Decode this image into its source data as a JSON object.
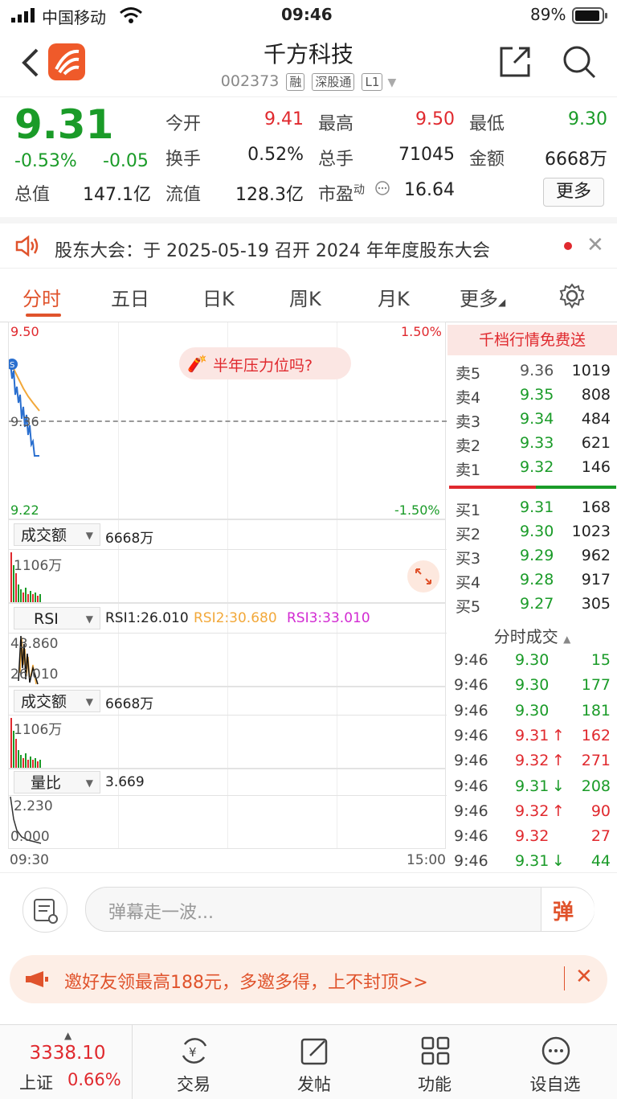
{
  "status": {
    "carrier": "中国移动",
    "time": "09:46",
    "battery": "89%"
  },
  "header": {
    "title": "千方科技",
    "code": "002373",
    "tags": [
      "融",
      "深股通",
      "L1"
    ]
  },
  "quote": {
    "price": "9.31",
    "change_pct": "-0.53%",
    "change": "-0.05",
    "fields": [
      {
        "label": "今开",
        "value": "9.41",
        "color": "red"
      },
      {
        "label": "最高",
        "value": "9.50",
        "color": "red"
      },
      {
        "label": "最低",
        "value": "9.30",
        "color": "green"
      },
      {
        "label": "换手",
        "value": "0.52%",
        "color": "normal"
      },
      {
        "label": "总手",
        "value": "71045",
        "color": "normal"
      },
      {
        "label": "金额",
        "value": "6668万",
        "color": "normal"
      },
      {
        "label": "总值",
        "value": "147.1亿",
        "color": "normal"
      },
      {
        "label": "流值",
        "value": "128.3亿",
        "color": "normal"
      },
      {
        "label": "市盈",
        "sup": "动",
        "value": "16.64",
        "color": "normal"
      }
    ],
    "more_label": "更多"
  },
  "notice": {
    "text": "股东大会：于 2025-05-19 召开 2024 年年度股东大会"
  },
  "tabs": [
    "分时",
    "五日",
    "日K",
    "周K",
    "月K",
    "更多"
  ],
  "chart": {
    "price_high": "9.50",
    "pct_high": "1.50%",
    "price_mid": "9.36",
    "price_low": "9.22",
    "pct_low": "-1.50%",
    "bubble": "半年压力位吗?",
    "vol_selector": "成交额",
    "vol_value": "6668万",
    "vol_max": "1106万",
    "rsi_selector": "RSI",
    "rsi1": "RSI1:26.010",
    "rsi2": "RSI2:30.680",
    "rsi3": "RSI3:33.010",
    "rsi_top": "43.860",
    "rsi_bottom": "26.010",
    "vol2_selector": "成交额",
    "vol2_value": "6668万",
    "vol2_max": "1106万",
    "lb_selector": "量比",
    "lb_value": "3.669",
    "lb_top": "2.230",
    "lb_bottom": "0.000",
    "time_start": "09:30",
    "time_end": "15:00"
  },
  "book": {
    "banner": "千档行情免费送",
    "asks": [
      {
        "label": "卖5",
        "price": "9.36",
        "vol": "1019",
        "color": "gray"
      },
      {
        "label": "卖4",
        "price": "9.35",
        "vol": "808",
        "color": "green"
      },
      {
        "label": "卖3",
        "price": "9.34",
        "vol": "484",
        "color": "green"
      },
      {
        "label": "卖2",
        "price": "9.33",
        "vol": "621",
        "color": "green"
      },
      {
        "label": "卖1",
        "price": "9.32",
        "vol": "146",
        "color": "green"
      }
    ],
    "bids": [
      {
        "label": "买1",
        "price": "9.31",
        "vol": "168",
        "color": "green"
      },
      {
        "label": "买2",
        "price": "9.30",
        "vol": "1023",
        "color": "green"
      },
      {
        "label": "买3",
        "price": "9.29",
        "vol": "962",
        "color": "green"
      },
      {
        "label": "买4",
        "price": "9.28",
        "vol": "917",
        "color": "green"
      },
      {
        "label": "买5",
        "price": "9.27",
        "vol": "305",
        "color": "green"
      }
    ],
    "ticks_title": "分时成交",
    "ticks": [
      {
        "time": "9:46",
        "price": "9.30",
        "vol": "15",
        "dir": "",
        "c": "green"
      },
      {
        "time": "9:46",
        "price": "9.30",
        "vol": "177",
        "dir": "",
        "c": "green"
      },
      {
        "time": "9:46",
        "price": "9.30",
        "vol": "181",
        "dir": "",
        "c": "green"
      },
      {
        "time": "9:46",
        "price": "9.31",
        "vol": "162",
        "dir": "↑",
        "c": "red"
      },
      {
        "time": "9:46",
        "price": "9.32",
        "vol": "271",
        "dir": "↑",
        "c": "red"
      },
      {
        "time": "9:46",
        "price": "9.31",
        "vol": "208",
        "dir": "↓",
        "c": "green"
      },
      {
        "time": "9:46",
        "price": "9.32",
        "vol": "90",
        "dir": "↑",
        "c": "red"
      },
      {
        "time": "9:46",
        "price": "9.32",
        "vol": "27",
        "dir": "",
        "c": "red"
      },
      {
        "time": "9:46",
        "price": "9.31",
        "vol": "44",
        "dir": "↓",
        "c": "green"
      }
    ]
  },
  "comment": {
    "placeholder": "弹幕走一波...",
    "danmu": "弹"
  },
  "invite": {
    "text": "邀好友领最高188元，多邀多得，上不封顶>>"
  },
  "bottom": {
    "index_value": "3338.10",
    "index_name": "上证",
    "index_pct": "0.66%",
    "items": [
      "交易",
      "发帖",
      "功能",
      "设自选"
    ]
  }
}
